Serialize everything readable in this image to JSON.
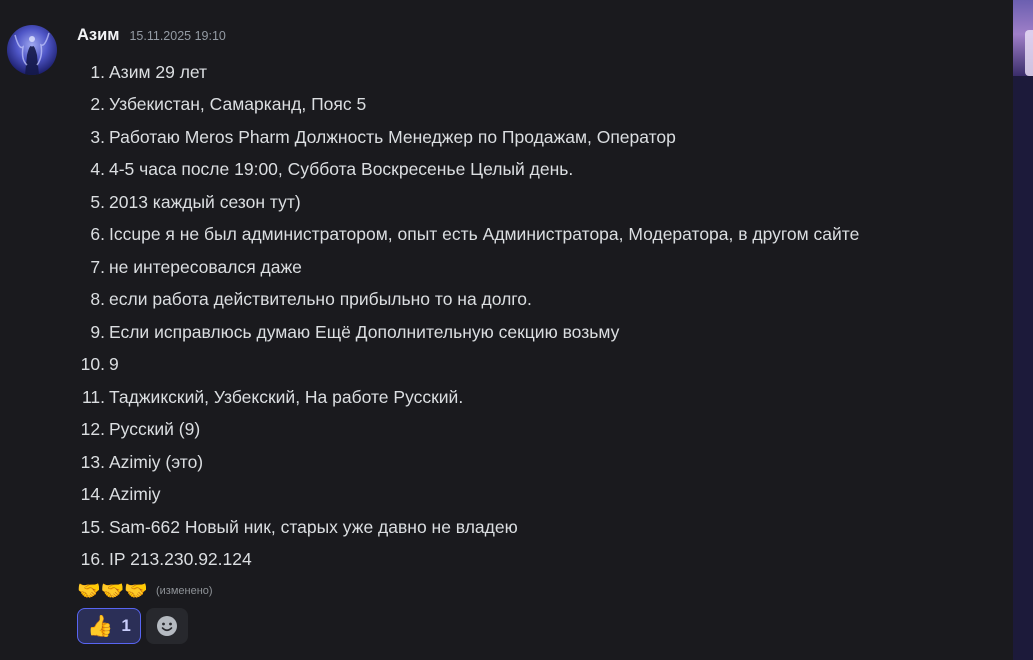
{
  "message": {
    "username": "Азим",
    "timestamp": "15.11.2025 19:10",
    "items": [
      {
        "num": "1.",
        "text": "Азим 29 лет"
      },
      {
        "num": "2.",
        "text": "Узбекистан, Самарканд, Пояс 5"
      },
      {
        "num": "3.",
        "text": "Работаю Meros Pharm Должность Менеджер по Продажам, Оператор"
      },
      {
        "num": "4.",
        "text": "4-5 часа после 19:00, Суббота Воскресенье Целый день."
      },
      {
        "num": "5.",
        "text": "2013 каждый сезон тут)"
      },
      {
        "num": "6.",
        "text": "Iccupe я не был администратором, опыт есть Администратора, Модератора, в другом сайте"
      },
      {
        "num": "7.",
        "text": "не интересовался даже"
      },
      {
        "num": "8.",
        "text": "если работа действительно прибыльно то на долго."
      },
      {
        "num": "9.",
        "text": "Если исправлюсь думаю Ещё Дополнительную секцию возьму"
      },
      {
        "num": "10.",
        "text": "9"
      },
      {
        "num": "11.",
        "text": "Таджикский, Узбекский, На работе Русский."
      },
      {
        "num": "12.",
        "text": "Русский (9)"
      },
      {
        "num": "13.",
        "text": "Azimiy (это)"
      },
      {
        "num": "14.",
        "text": "Azimiy"
      },
      {
        "num": "15.",
        "text": "Sam-662 Новый ник, старых уже давно не владею"
      },
      {
        "num": "16.",
        "text": "IP 213.230.92.124"
      }
    ],
    "trailing_emoji": "🤝🤝🤝",
    "edited_label": "(изменено)"
  },
  "reactions": {
    "thumbs_up_emoji": "👍",
    "thumbs_up_count": "1",
    "add_reaction_icon": "smile-face-icon"
  },
  "colors": {
    "background": "#1a1a1e",
    "text": "#dbdee1",
    "username": "#f2f3f5",
    "timestamp": "#949ba4",
    "reaction_active_bg": "#2b2f57",
    "reaction_active_border": "#5865f2",
    "reaction_count": "#c9cdfb",
    "add_reaction_bg": "#27282d"
  }
}
